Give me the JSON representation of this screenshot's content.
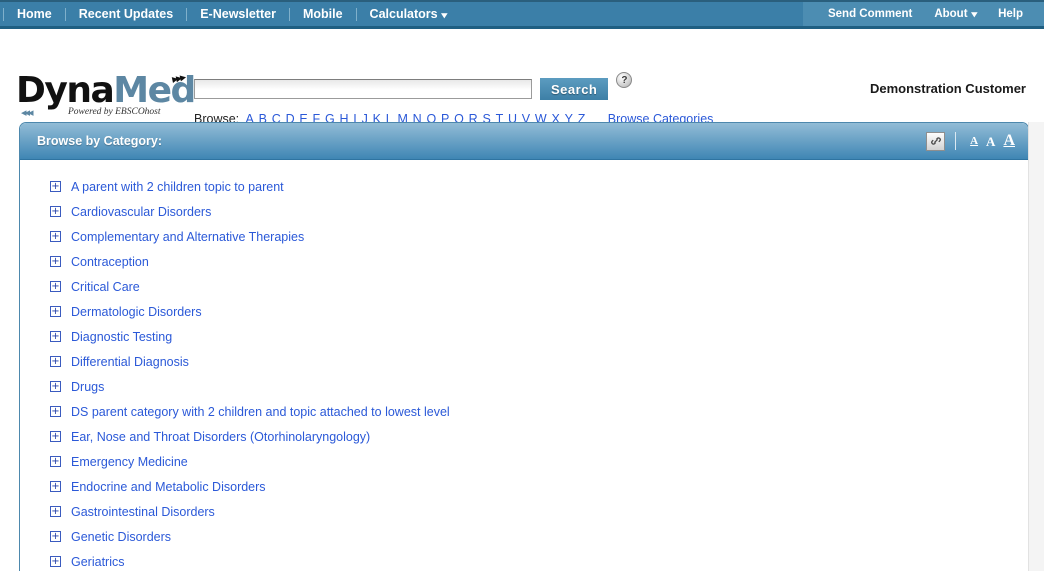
{
  "topnav": {
    "left_items": [
      {
        "label": "Home",
        "icon": null
      },
      {
        "label": "Recent Updates",
        "icon": null
      },
      {
        "label": "E-Newsletter",
        "icon": null
      },
      {
        "label": "Mobile",
        "icon": null
      },
      {
        "label": "Calculators",
        "icon": "chevron-down-icon"
      }
    ],
    "right_items": [
      {
        "label": "Send Comment",
        "icon": null
      },
      {
        "label": "About",
        "icon": "chevron-down-icon"
      },
      {
        "label": "Help",
        "icon": null
      }
    ]
  },
  "brand": {
    "name_part1": "Dyna",
    "name_part2": "Med",
    "tagline": "Powered by EBSCOhost",
    "arrows_top": "▸▸▸",
    "arrows_bottom": "◂◂◂"
  },
  "search": {
    "value": "",
    "placeholder": "",
    "button_label": "Search",
    "help_icon_glyph": "?",
    "help_icon_name": "question-mark-icon"
  },
  "browse": {
    "label": "Browse:",
    "letters": [
      "A",
      "B",
      "C",
      "D",
      "E",
      "F",
      "G",
      "H",
      "I",
      "J",
      "K",
      "L",
      "M",
      "N",
      "O",
      "P",
      "Q",
      "R",
      "S",
      "T",
      "U",
      "V",
      "W",
      "X",
      "Y",
      "Z"
    ],
    "categories_link": "Browse Categories"
  },
  "account": {
    "customer_name": "Demonstration Customer"
  },
  "card": {
    "title": "Browse by Category:",
    "tools": {
      "link_icon_name": "chain-link-icon",
      "link_icon_glyph": "🔗",
      "font_small": "A",
      "font_medium": "A",
      "font_large": "A"
    },
    "expand_glyph": "+",
    "items": [
      {
        "label": "A parent with 2 children topic to parent"
      },
      {
        "label": "Cardiovascular Disorders"
      },
      {
        "label": "Complementary and Alternative Therapies"
      },
      {
        "label": "Contraception"
      },
      {
        "label": "Critical Care"
      },
      {
        "label": "Dermatologic Disorders"
      },
      {
        "label": "Diagnostic Testing"
      },
      {
        "label": "Differential Diagnosis"
      },
      {
        "label": "Drugs"
      },
      {
        "label": "DS parent category with 2 children and topic attached to lowest level"
      },
      {
        "label": "Ear, Nose and Throat Disorders (Otorhinolaryngology)"
      },
      {
        "label": "Emergency Medicine"
      },
      {
        "label": "Endocrine and Metabolic Disorders"
      },
      {
        "label": "Gastrointestinal Disorders"
      },
      {
        "label": "Genetic Disorders"
      },
      {
        "label": "Geriatrics"
      }
    ]
  },
  "colors": {
    "nav_bg": "#3b7fa8",
    "nav_right_bg": "#4c8db2",
    "nav_border": "#1f5f82",
    "header_gradient_top": "#92bcd6",
    "header_gradient_bottom": "#3f86b4",
    "link_blue": "#2b59d8",
    "brand_blue": "#5d87a3",
    "search_button": "#3d7fa6"
  }
}
